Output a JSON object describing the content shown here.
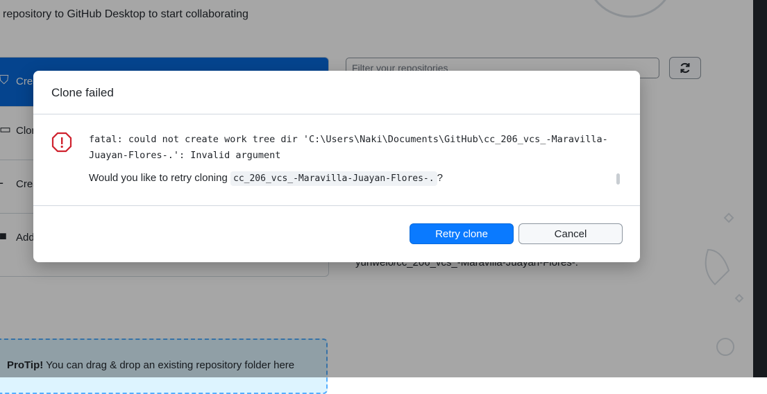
{
  "background": {
    "subtitle": "repository to GitHub Desktop to start collaborating",
    "left_items": [
      {
        "label": "Crea",
        "icon": "mortarboard-icon"
      },
      {
        "label": "Clon",
        "icon": "desktop-icon"
      },
      {
        "label": "Crea",
        "icon": "plus-icon"
      },
      {
        "label": "Add",
        "icon": "folder-icon"
      }
    ],
    "filter_placeholder": "Filter your repositories",
    "repo_item": "yunwelo/cc_206_vcs_-Maravilla-Juayan-Flores-.",
    "protip_bold": "ProTip!",
    "protip_text": " You can drag & drop an existing repository folder here"
  },
  "dialog": {
    "title": "Clone failed",
    "error_message": "fatal: could not create work tree dir 'C:\\Users\\Naki\\Documents\\GitHub\\cc_206_vcs_-Maravilla-Juayan-Flores-.': Invalid argument",
    "question_prefix": "Would you like to retry cloning ",
    "repo_name": "cc_206_vcs_-Maravilla-Juayan-Flores-.",
    "question_suffix": "?",
    "retry_label": "Retry clone",
    "cancel_label": "Cancel"
  },
  "colors": {
    "primary": "#0a7aff",
    "error": "#cf222e"
  }
}
